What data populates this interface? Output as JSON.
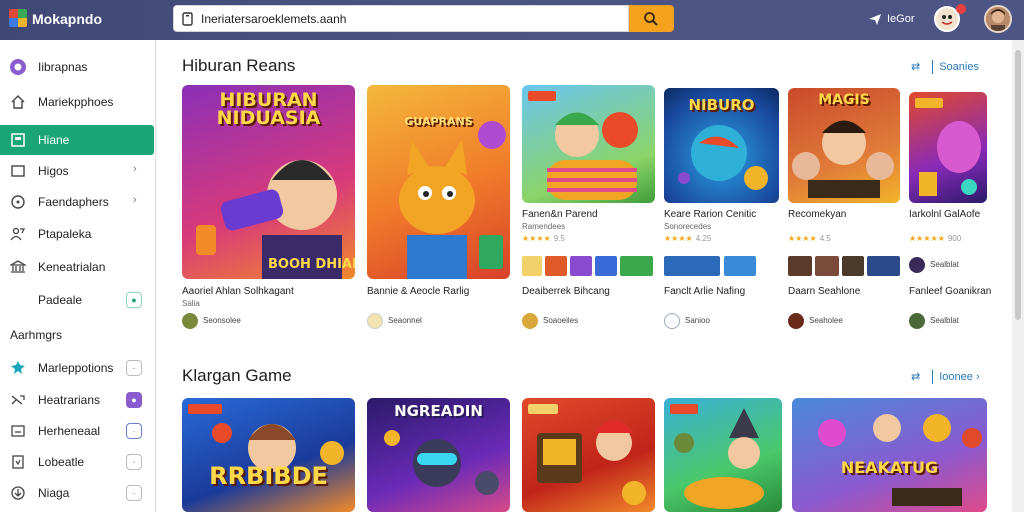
{
  "app": {
    "title": "Mokapndo"
  },
  "search": {
    "value": "Ineriatersaroeklemets.aanh"
  },
  "topbar": {
    "right_label": "IeGor"
  },
  "sidebar": {
    "items": [
      {
        "label": "Iibrapnas",
        "icon": "circle-logo-icon"
      },
      {
        "label": "Mariekpphoes",
        "icon": "home-icon"
      },
      {
        "label": "Hiane",
        "icon": "grid-icon"
      },
      {
        "label": "Higos",
        "icon": "square-icon"
      },
      {
        "label": "Faendaphers",
        "icon": "compass-icon"
      },
      {
        "label": "Ptapaleka",
        "icon": "people-icon"
      },
      {
        "label": "Keneatrialan",
        "icon": "bank-icon"
      },
      {
        "label": "Padeale",
        "icon": "blank-icon"
      }
    ],
    "heading": "Aarhmgrs",
    "items2": [
      {
        "label": "Marleppotions",
        "icon": "puzzle-icon"
      },
      {
        "label": "Heatrarians",
        "icon": "swap-icon"
      },
      {
        "label": "Herheneaal",
        "icon": "window-icon"
      },
      {
        "label": "Lobeatle",
        "icon": "phone-icon"
      },
      {
        "label": "Niaga",
        "icon": "download-icon"
      }
    ]
  },
  "section1": {
    "title": "Hiburan Reans",
    "action": "Soanies",
    "cards": [
      {
        "caption": "HIBURAN NIDUASIA",
        "title": "Aaoriel Ahlan Solhkagant",
        "sub": "Salia",
        "dev": "Seonsolee"
      },
      {
        "caption": "GUAPRANS",
        "title": "Bannie & Aeocle Rarlig",
        "sub": "",
        "dev": "Seaonnel"
      },
      {
        "caption": "",
        "title": "Fanen&n Parend",
        "sub": "Ramendees",
        "stars": "★★★★",
        "rating": "9.5",
        "title2": "Deaiberrek Bihcang",
        "dev": "Soaoeiles"
      },
      {
        "caption": "NIBURO",
        "title": "Keare Rarion Cenitic",
        "sub": "Sonorecedes",
        "stars": "★★★★",
        "rating": "4.25",
        "title2": "Fanclt Arlie Nafing",
        "dev": "Sanioo"
      },
      {
        "caption": "MAGIS",
        "title": "Recomekyan",
        "sub": "",
        "stars": "★★★★",
        "rating": "4.5",
        "title2": "Daarn Seahlone",
        "dev": "Seaholee"
      },
      {
        "caption": "",
        "title": "Iarkolnl GalAofe",
        "sub": "",
        "stars": "★★★★★",
        "rating": "900",
        "title2": "Fanleef Goanikran",
        "dev": "Sealblat"
      }
    ]
  },
  "section2": {
    "title": "Klargan Game",
    "action": "Ioonee",
    "cards": [
      {
        "caption": "RRBIBDE"
      },
      {
        "caption": "NGREADIN"
      },
      {
        "caption": ""
      },
      {
        "caption": ""
      },
      {
        "caption": "NEAKATUG"
      }
    ]
  }
}
